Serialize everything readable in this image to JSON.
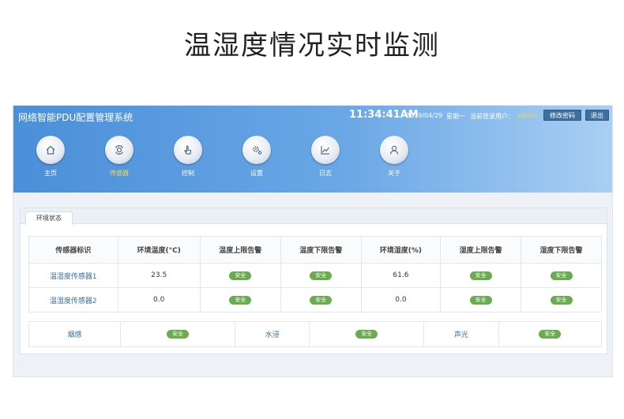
{
  "page_title": "温湿度情况实时监测",
  "header": {
    "system_title": "网络智能PDU配置管理系统",
    "time": "11:34:41AM",
    "date": "2019/04/29",
    "weekday": "星期一",
    "user_label": "当前登录用户：",
    "user_name": "admin",
    "change_password": "修改密码",
    "logout": "退出",
    "accent_color": "#f5d94c"
  },
  "nav": [
    {
      "label": "主页",
      "icon": "home-icon",
      "active": false
    },
    {
      "label": "传感器",
      "icon": "sensor-icon",
      "active": true
    },
    {
      "label": "控制",
      "icon": "hand-pointer-icon",
      "active": false
    },
    {
      "label": "设置",
      "icon": "gear-icon",
      "active": false
    },
    {
      "label": "日志",
      "icon": "chart-log-icon",
      "active": false
    },
    {
      "label": "关于",
      "icon": "user-icon",
      "active": false
    }
  ],
  "tab": {
    "label": "环境状态"
  },
  "sensor_table": {
    "headers": [
      "传感器标识",
      "环境温度(°C)",
      "温度上限告警",
      "温度下限告警",
      "环境湿度(%)",
      "湿度上限告警",
      "湿度下限告警"
    ],
    "rows": [
      {
        "name": "温湿度传感器1",
        "temp": "23.5",
        "temp_high": "安全",
        "temp_low": "安全",
        "humidity": "61.6",
        "hum_high": "安全",
        "hum_low": "安全"
      },
      {
        "name": "温湿度传感器2",
        "temp": "0.0",
        "temp_high": "安全",
        "temp_low": "安全",
        "humidity": "0.0",
        "hum_high": "安全",
        "hum_low": "安全"
      }
    ]
  },
  "env_table": {
    "items": [
      {
        "label": "烟感",
        "status": "安全"
      },
      {
        "label": "水浸",
        "status": "安全"
      },
      {
        "label": "声光",
        "status": "安全"
      }
    ]
  },
  "status_color": "#6aab4f"
}
